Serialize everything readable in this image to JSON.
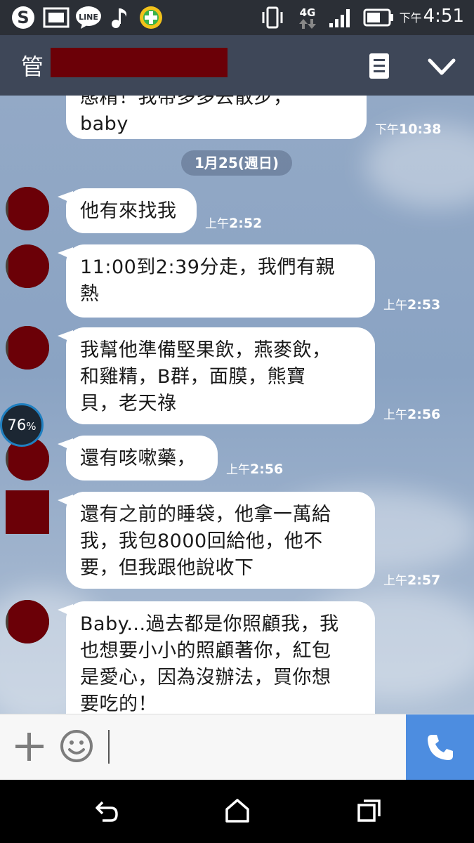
{
  "status_bar": {
    "time_prefix": "下午",
    "time": "4:51",
    "network": "4G",
    "icons": [
      "skype-icon",
      "gallery-icon",
      "line-icon",
      "music-icon",
      "plus-app-icon",
      "vibrate-icon",
      "signal-icon",
      "battery-icon"
    ]
  },
  "header": {
    "title": "管",
    "menu_icon": "menu-icon",
    "collapse_icon": "chevron-down-icon"
  },
  "chat": {
    "date_divider": "1月25(週日)",
    "messages": [
      {
        "text_line1": "態精！我帶多多去散步，",
        "text_line2": "baby",
        "time_prefix": "下午",
        "time": "10:38"
      },
      {
        "text": "他有來找我",
        "time_prefix": "上午",
        "time": "2:52"
      },
      {
        "text_line1": "11:00到2:39分走，我們有親",
        "text_line2": "熱",
        "time_prefix": "上午",
        "time": "2:53"
      },
      {
        "text_line1": "我幫他準備堅果飲，燕麥飲，",
        "text_line2": "和雞精，B群，面膜，熊寶",
        "text_line3": "貝，老天祿",
        "time_prefix": "上午",
        "time": "2:56"
      },
      {
        "text": "還有咳嗽藥，",
        "time_prefix": "上午",
        "time": "2:56"
      },
      {
        "text_line1": "還有之前的睡袋，他拿一萬給",
        "text_line2": "我，我包8000回給他，他不",
        "text_line3": "要，但我跟他說收下",
        "time_prefix": "上午",
        "time": "2:57"
      },
      {
        "text_line1": "Baby...過去都是你照顧我，我",
        "text_line2": "也想要小小的照顧著你，紅包",
        "text_line3": "是愛心，因為沒辦法，買你想",
        "text_line4": "要吃的！"
      }
    ]
  },
  "battery_widget": {
    "value": "76",
    "unit": "%"
  },
  "input_bar": {
    "placeholder": ""
  },
  "colors": {
    "header": "#3e4758",
    "status_bar": "#2b2f36",
    "call_button": "#4d8de0",
    "redaction": "#6b0007"
  }
}
